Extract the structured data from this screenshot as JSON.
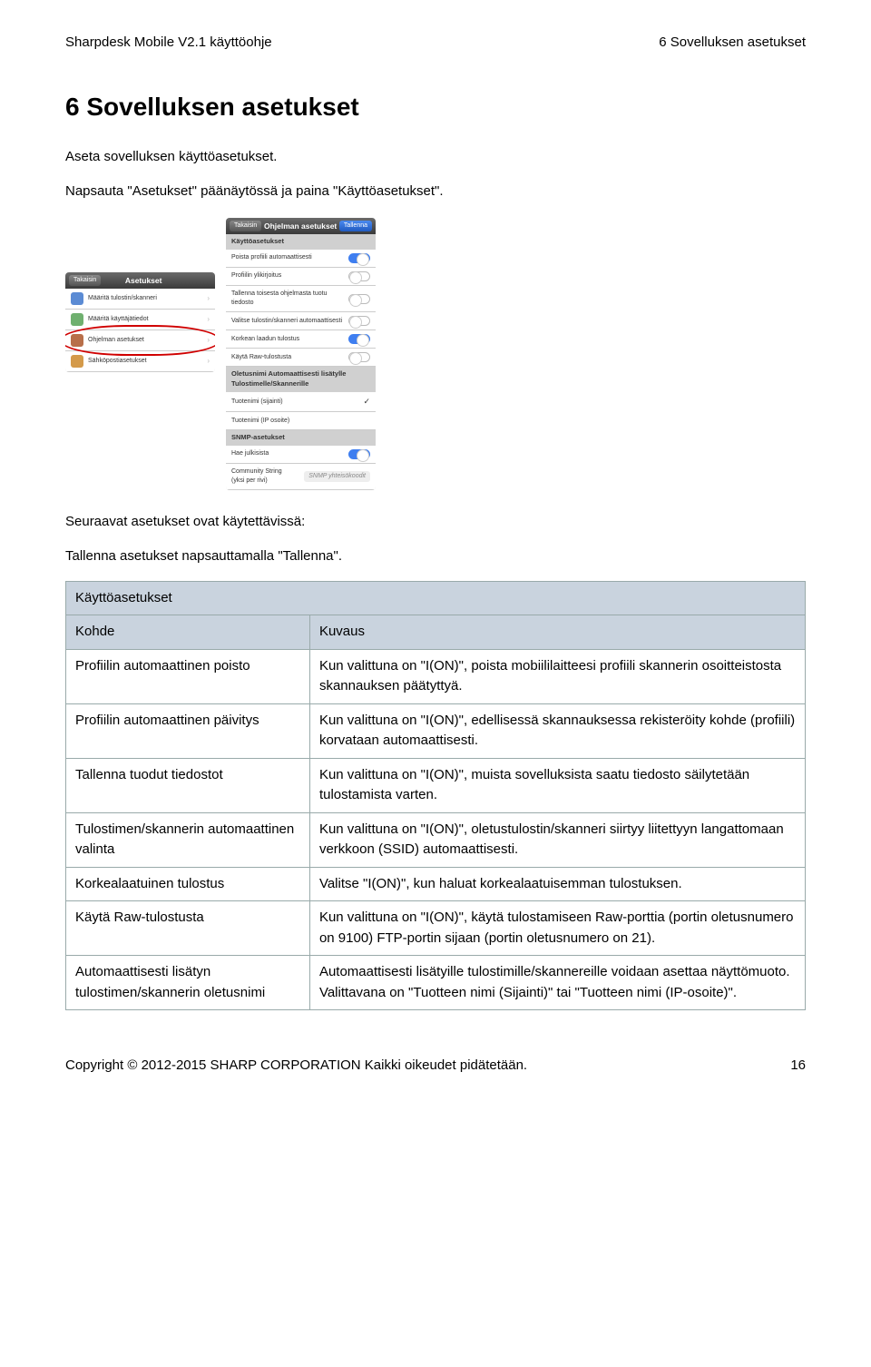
{
  "header": {
    "left": "Sharpdesk Mobile V2.1 käyttöohje",
    "right": "6 Sovelluksen asetukset"
  },
  "section_title": "6   Sovelluksen asetukset",
  "intro1": "Aseta sovelluksen käyttöasetukset.",
  "intro2": "Napsauta \"Asetukset\" päänäytössä ja paina \"Käyttöasetukset\".",
  "intro3": "Seuraavat asetukset ovat käytettävissä:",
  "intro4": "Tallenna asetukset napsauttamalla \"Tallenna\".",
  "phone1": {
    "back": "Takaisin",
    "title": "Asetukset",
    "r1": "Määritä tulostin/skanneri",
    "r2": "Määritä käyttäjätiedot",
    "r3": "Ohjelman asetukset",
    "r4": "Sähköpostiasetukset"
  },
  "phone2": {
    "back": "Takaisin",
    "title": "Ohjelman asetukset",
    "save": "Tallenna",
    "g1": "Käyttöasetukset",
    "r1": "Poista profiili automaattisesti",
    "r2": "Profiilin ylikirjoitus",
    "r3": "Tallenna toisesta ohjelmasta tuotu tiedosto",
    "r4": "Valitse tulostin/skanneri automaattisesti",
    "r5": "Korkean laadun tulostus",
    "r6": "Käytä Raw-tulostusta",
    "g2": "Oletusnimi Automaattisesti lisätylle Tulostimelle/Skannerille",
    "r7": "Tuotenimi (sijainti)",
    "r8": "Tuotenimi (IP osoite)",
    "g3": "SNMP-asetukset",
    "r9": "Hae julkisista",
    "r10": "Community String (yksi per rivi)",
    "r10ph": "SNMP yhteisökoodit"
  },
  "table": {
    "group": "Käyttöasetukset",
    "h1": "Kohde",
    "h2": "Kuvaus",
    "r1a": "Profiilin automaattinen poisto",
    "r1b": "Kun valittuna on \"I(ON)\", poista mobiililaitteesi profiili skannerin osoitteistosta skannauksen päätyttyä.",
    "r2a": "Profiilin automaattinen päivitys",
    "r2b": "Kun valittuna on \"I(ON)\", edellisessä skannauksessa rekisteröity kohde (profiili) korvataan automaattisesti.",
    "r3a": "Tallenna tuodut tiedostot",
    "r3b": "Kun valittuna on \"I(ON)\", muista sovelluksista saatu tiedosto säilytetään tulostamista varten.",
    "r4a": "Tulostimen/skannerin automaattinen valinta",
    "r4b": "Kun valittuna on \"I(ON)\", oletustulostin/skanneri siirtyy liitettyyn langattomaan verkkoon (SSID) automaattisesti.",
    "r5a": "Korkealaatuinen tulostus",
    "r5b": "Valitse \"I(ON)\", kun haluat korkealaatuisemman tulostuksen.",
    "r6a": "Käytä Raw-tulostusta",
    "r6b": "Kun valittuna on \"I(ON)\", käytä tulostamiseen Raw-porttia (portin oletusnumero on 9100) FTP-portin sijaan (portin oletusnumero on 21).",
    "r7a": "Automaattisesti lisätyn tulostimen/skannerin oletusnimi",
    "r7b": "Automaattisesti lisätyille tulostimille/skannereille voidaan asettaa näyttömuoto. Valittavana on \"Tuotteen nimi (Sijainti)\" tai \"Tuotteen nimi (IP-osoite)\"."
  },
  "footer": {
    "left": "Copyright © 2012-2015 SHARP CORPORATION Kaikki oikeudet pidätetään.",
    "right": "16"
  }
}
